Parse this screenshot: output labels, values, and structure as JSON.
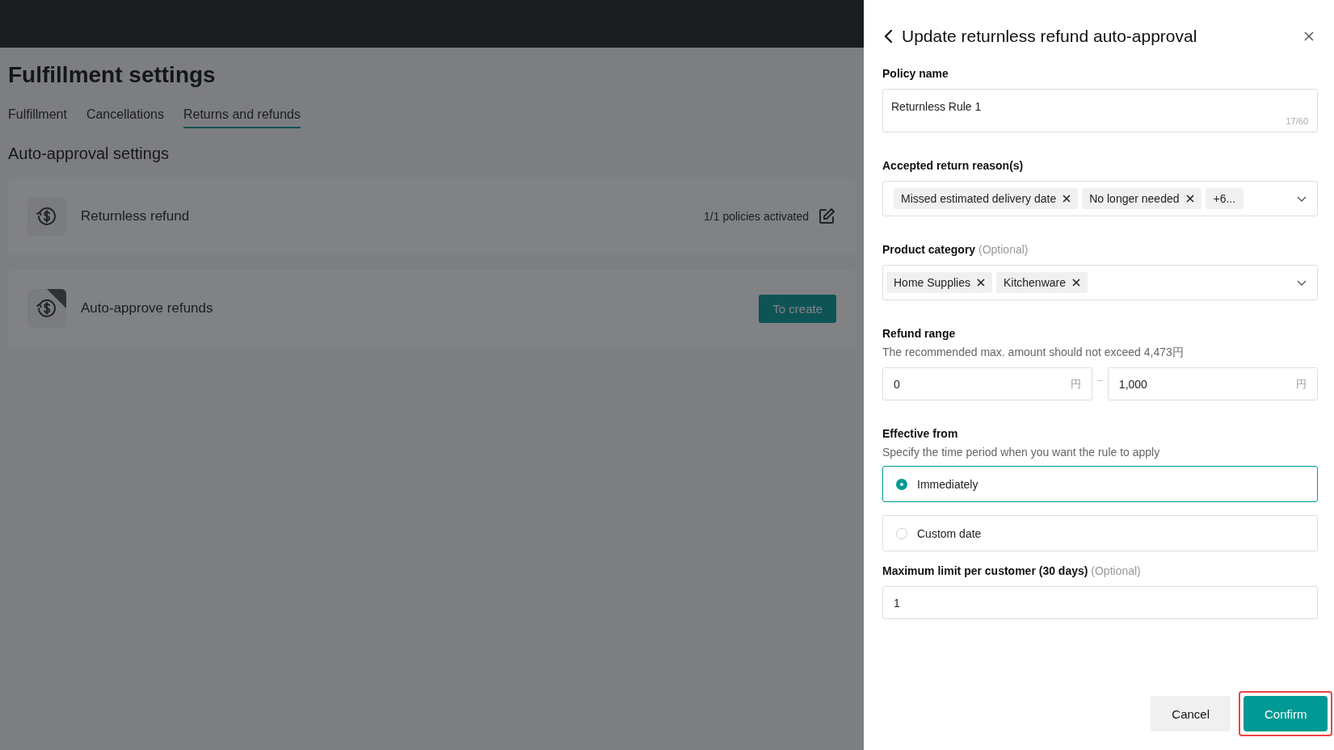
{
  "page": {
    "title": "Fulfillment settings",
    "tabs": [
      {
        "label": "Fulfillment",
        "selected": false
      },
      {
        "label": "Cancellations",
        "selected": false
      },
      {
        "label": "Returns and refunds",
        "selected": true
      }
    ],
    "section_title": "Auto-approval settings",
    "cards": [
      {
        "title": "Returnless refund",
        "kind": "status",
        "status": "1/1 policies activated",
        "ribbon": false
      },
      {
        "title": "Auto-approve refunds",
        "kind": "create",
        "action": "To create",
        "ribbon": true
      }
    ]
  },
  "drawer": {
    "title": "Update returnless refund auto-approval",
    "policy_name": {
      "label": "Policy name",
      "value": "Returnless Rule 1",
      "counter": "17/60"
    },
    "return_reasons": {
      "label": "Accepted return reason(s)",
      "tags": [
        "Missed estimated delivery date",
        "No longer needed"
      ],
      "more": "+6..."
    },
    "product_category": {
      "label": "Product category",
      "optional": "(Optional)",
      "tags": [
        "Home Supplies",
        "Kitchenware"
      ]
    },
    "refund_range": {
      "label": "Refund range",
      "hint": "The recommended max. amount should not exceed 4,473円",
      "separator": "–",
      "min": {
        "value": "0",
        "unit": "円"
      },
      "max": {
        "value": "1,000",
        "unit": "円"
      }
    },
    "effective_from": {
      "label": "Effective from",
      "hint": "Specify the time period when you want the rule to apply",
      "options": [
        {
          "label": "Immediately",
          "selected": true
        },
        {
          "label": "Custom date",
          "selected": false
        }
      ]
    },
    "max_limit": {
      "label": "Maximum limit per customer (30 days)",
      "optional": "(Optional)",
      "value": "1"
    },
    "buttons": [
      {
        "label": "Cancel",
        "kind": "secondary",
        "highlighted": false
      },
      {
        "label": "Confirm",
        "kind": "primary",
        "highlighted": true
      }
    ]
  }
}
